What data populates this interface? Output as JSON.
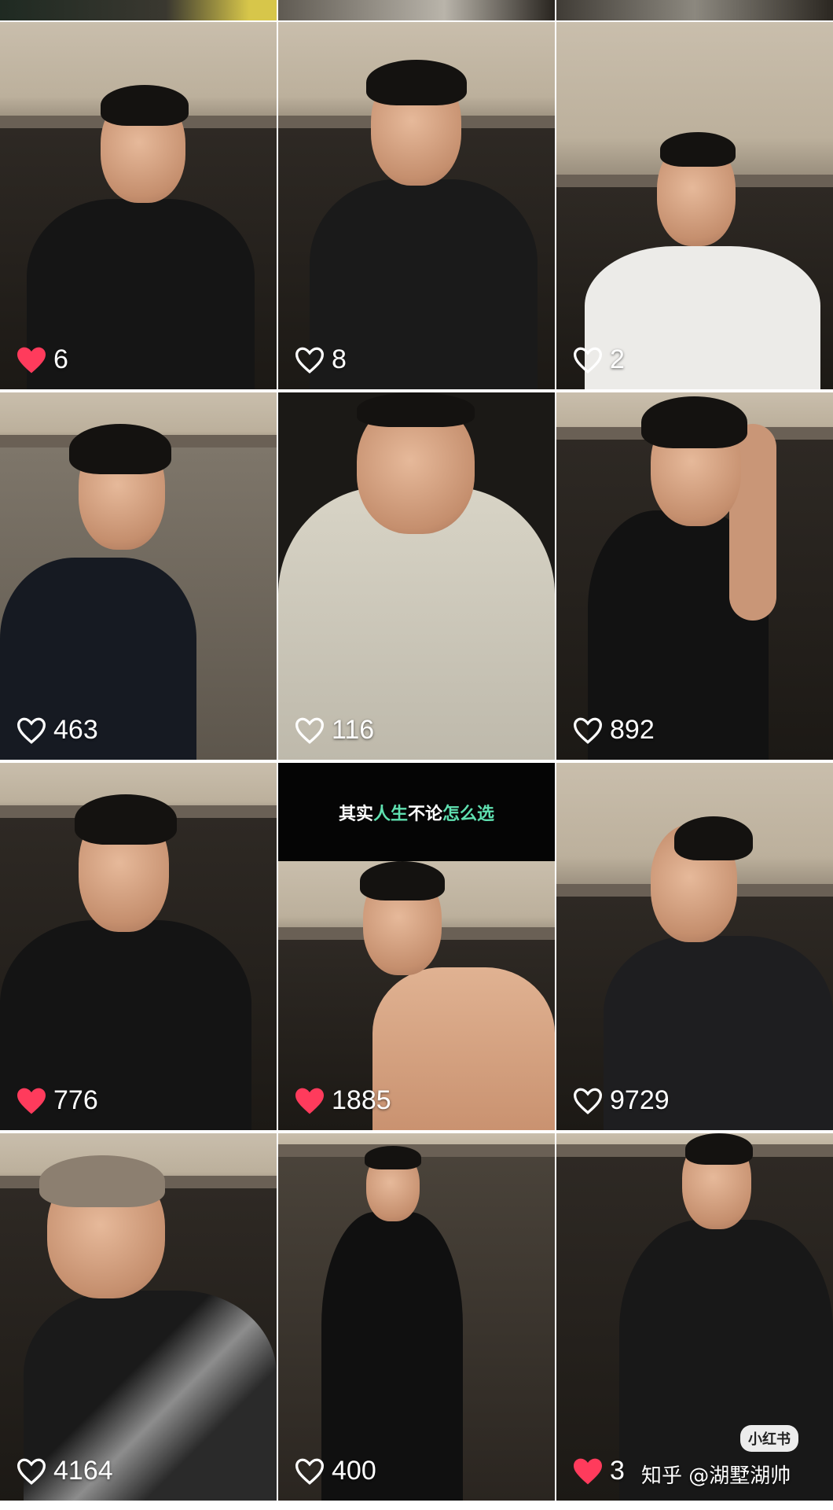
{
  "accent": {
    "liked_heart": "#ff3b5c",
    "unliked_heart": "#ffffff"
  },
  "tiles": [
    {
      "likes": "6",
      "liked": true
    },
    {
      "likes": "8",
      "liked": false
    },
    {
      "likes": "2",
      "liked": false
    },
    {
      "likes": "463",
      "liked": false
    },
    {
      "likes": "116",
      "liked": false
    },
    {
      "likes": "892",
      "liked": false
    },
    {
      "likes": "776",
      "liked": true
    },
    {
      "likes": "1885",
      "liked": true,
      "caption": {
        "part1": "其实",
        "part2": "人生",
        "part3": "不论",
        "part4": "怎么选"
      }
    },
    {
      "likes": "9729",
      "liked": false
    },
    {
      "likes": "4164",
      "liked": false
    },
    {
      "likes": "400",
      "liked": false
    },
    {
      "likes": "3",
      "liked": true
    }
  ],
  "badge": {
    "label": "小红书"
  },
  "watermark": {
    "text": "知乎 @湖墅湖帅"
  }
}
